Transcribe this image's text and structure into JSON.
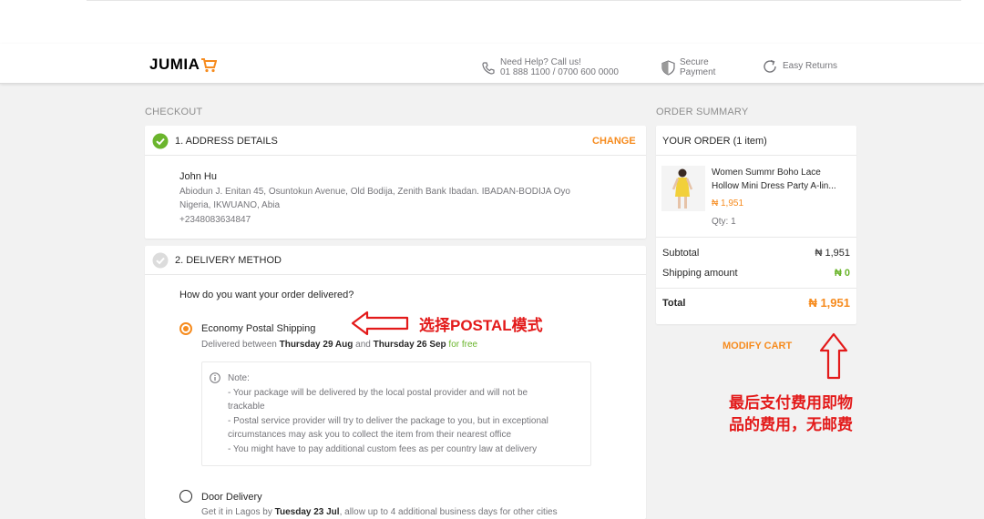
{
  "header": {
    "logo": "JUMIA",
    "help_line1": "Need Help? Call us!",
    "help_line2": "01 888 1100 / 0700 600 0000",
    "secure_line1": "Secure",
    "secure_line2": "Payment",
    "returns": "Easy Returns"
  },
  "checkout": {
    "title": "CHECKOUT",
    "address": {
      "step_title": "1. ADDRESS DETAILS",
      "change": "CHANGE",
      "name": "John Hu",
      "line1": "Abiodun J. Enitan 45, Osuntokun Avenue, Old Bodija, Zenith Bank Ibadan. IBADAN-BODIJA Oyo",
      "line2": "Nigeria, IKWUANO, Abia",
      "phone": "+2348083634847"
    },
    "delivery": {
      "step_title": "2. DELIVERY METHOD",
      "question": "How do you want your order delivered?",
      "option1": {
        "label": "Economy Postal Shipping",
        "prefix": "Delivered between ",
        "date1": "Thursday 29 Aug",
        "and": " and ",
        "date2": "Thursday 26 Sep",
        "free": " for free"
      },
      "note": {
        "title": "Note:",
        "lines": [
          "- Your package will be delivered by the local postal provider and will not be",
          "trackable",
          "- Postal service provider will try to deliver the package to you, but in exceptional",
          "circumstances may ask you to collect the item from their nearest office",
          "- You might have to pay additional custom fees as per country law at delivery"
        ]
      },
      "option2": {
        "label": "Door Delivery",
        "prefix": "Get it in Lagos by ",
        "date": "Tuesday 23 Jul",
        "suffix": ", allow up to 4 additional business days for other cities"
      }
    }
  },
  "summary": {
    "title": "ORDER SUMMARY",
    "your_order": "YOUR ORDER",
    "item_count": "(1 item)",
    "product_line1": "Women Summr Boho Lace",
    "product_line2": "Hollow Mini Dress Party A-lin...",
    "product_price": "₦ 1,951",
    "qty": "Qty: 1",
    "subtotal_label": "Subtotal",
    "subtotal_value": "₦ 1,951",
    "shipping_label": "Shipping amount",
    "shipping_value": "₦ 0",
    "total_label": "Total",
    "total_value": "₦ 1,951",
    "modify_cart": "MODIFY CART"
  },
  "annotations": {
    "postal": "选择POSTAL模式",
    "fee_line1": "最后支付费用即物",
    "fee_line2": "品的费用，无邮费"
  },
  "colors": {
    "accent": "#f68b1e",
    "success": "#6bb52d",
    "annotation": "#e31a1a"
  }
}
